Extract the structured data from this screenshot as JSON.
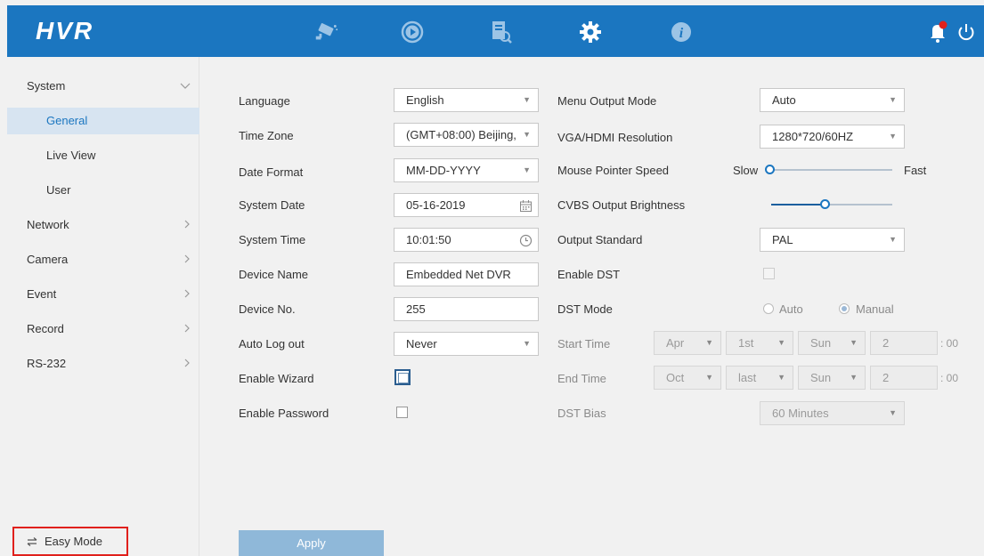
{
  "app": {
    "logo": "HVR"
  },
  "topbar": {
    "icons": [
      "camera-icon",
      "playback-icon",
      "search-file-icon",
      "gear-icon",
      "info-icon",
      "bell-icon",
      "power-icon"
    ],
    "accent": "#1b76c0",
    "notification_color": "#e0201c"
  },
  "sidebar": {
    "items": [
      {
        "label": "System",
        "expanded": true
      },
      {
        "label": "General",
        "active": true
      },
      {
        "label": "Live View"
      },
      {
        "label": "User"
      },
      {
        "label": "Network"
      },
      {
        "label": "Camera"
      },
      {
        "label": "Event"
      },
      {
        "label": "Record"
      },
      {
        "label": "RS-232"
      }
    ],
    "easy_mode": "Easy Mode"
  },
  "form": {
    "language": {
      "label": "Language",
      "value": "English"
    },
    "time_zone": {
      "label": "Time Zone",
      "value": "(GMT+08:00) Beijing,"
    },
    "date_format": {
      "label": "Date Format",
      "value": "MM-DD-YYYY"
    },
    "system_date": {
      "label": "System Date",
      "value": "05-16-2019"
    },
    "system_time": {
      "label": "System Time",
      "value": "10:01:50"
    },
    "device_name": {
      "label": "Device Name",
      "value": "Embedded Net DVR"
    },
    "device_no": {
      "label": "Device No.",
      "value": "255"
    },
    "auto_logout": {
      "label": "Auto Log out",
      "value": "Never"
    },
    "enable_wizard": {
      "label": "Enable Wizard",
      "checked": false
    },
    "enable_password": {
      "label": "Enable Password",
      "checked": false
    },
    "menu_output_mode": {
      "label": "Menu Output Mode",
      "value": "Auto"
    },
    "vga_resolution": {
      "label": "VGA/HDMI Resolution",
      "value": "1280*720/60HZ"
    },
    "mouse_speed": {
      "label": "Mouse Pointer Speed",
      "slow": "Slow",
      "fast": "Fast",
      "level": 0.0
    },
    "cvbs_brightness": {
      "label": "CVBS Output Brightness",
      "level": 0.45
    },
    "output_standard": {
      "label": "Output Standard",
      "value": "PAL"
    },
    "enable_dst": {
      "label": "Enable DST",
      "checked": false
    },
    "dst_mode": {
      "label": "DST Mode",
      "options": [
        "Auto",
        "Manual"
      ],
      "selected": "Manual"
    },
    "start_time": {
      "label": "Start Time",
      "month": "Apr",
      "week": "1st",
      "day": "Sun",
      "hour": "2",
      "suffix": ": 00"
    },
    "end_time": {
      "label": "End Time",
      "month": "Oct",
      "week": "last",
      "day": "Sun",
      "hour": "2",
      "suffix": ": 00"
    },
    "dst_bias": {
      "label": "DST Bias",
      "value": "60 Minutes"
    }
  },
  "actions": {
    "apply": "Apply"
  }
}
